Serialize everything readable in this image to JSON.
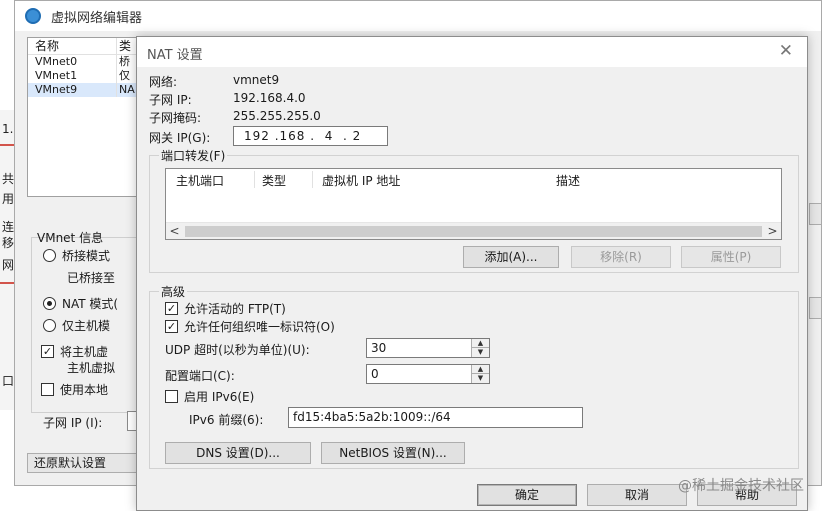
{
  "back_window": {
    "title": "虚拟网络编辑器",
    "list_headers": [
      "名称",
      "类"
    ],
    "networks": [
      {
        "name": "VMnet0",
        "type": "桥"
      },
      {
        "name": "VMnet1",
        "type": "仅"
      },
      {
        "name": "VMnet9",
        "type": "NA"
      }
    ],
    "vmnet_info_label": "VMnet 信息",
    "bridged_label": "桥接模式",
    "bridged_to_label": "已桥接至",
    "nat_mode_label": "NAT 模式(",
    "host_only_label": "仅主机模",
    "connect_host_label": "将主机虚",
    "host_virtual_label": "主机虚拟",
    "use_local_label": "使用本地",
    "subnet_ip_label": "子网 IP (I):",
    "restore_default_label": "还原默认设置",
    "edge_chars": [
      "1.",
      "共",
      "用",
      "连",
      "移",
      "网",
      "口"
    ]
  },
  "nat_dialog": {
    "title": "NAT 设置",
    "close_glyph": "✕",
    "network_label": "网络:",
    "network_value": "vmnet9",
    "subnet_ip_label": "子网 IP:",
    "subnet_ip_value": "192.168.4.0",
    "subnet_mask_label": "子网掩码:",
    "subnet_mask_value": "255.255.255.0",
    "gateway_label": "网关 IP(G):",
    "gateway_value": "192 .168 .  4  . 2",
    "port_forwarding": {
      "label": "端口转发(F)",
      "columns": [
        "主机端口",
        "类型",
        "虚拟机 IP 地址",
        "描述"
      ],
      "scroll_left": "<",
      "scroll_right": ">",
      "add_button": "添加(A)...",
      "remove_button": "移除(R)",
      "properties_button": "属性(P)"
    },
    "advanced": {
      "label": "高级",
      "allow_ftp_label": "允许活动的 FTP(T)",
      "allow_ftp_checked": true,
      "allow_oui_label": "允许任何组织唯一标识符(O)",
      "allow_oui_checked": true,
      "udp_timeout_label": "UDP 超时(以秒为单位)(U):",
      "udp_timeout_value": "30",
      "config_port_label": "配置端口(C):",
      "config_port_value": "0",
      "enable_ipv6_label": "启用 IPv6(E)",
      "enable_ipv6_checked": false,
      "ipv6_prefix_label": "IPv6 前缀(6):",
      "ipv6_prefix_value": "fd15:4ba5:5a2b:1009::/64",
      "dns_button": "DNS 设置(D)...",
      "netbios_button": "NetBIOS 设置(N)..."
    },
    "ok_button": "确定",
    "cancel_button": "取消",
    "help_button": "帮助"
  },
  "watermark": "@稀土掘金技术社区",
  "icons": {
    "app": "network-globe-icon",
    "check": "✓",
    "spin_up": "▲",
    "spin_down": "▼"
  }
}
